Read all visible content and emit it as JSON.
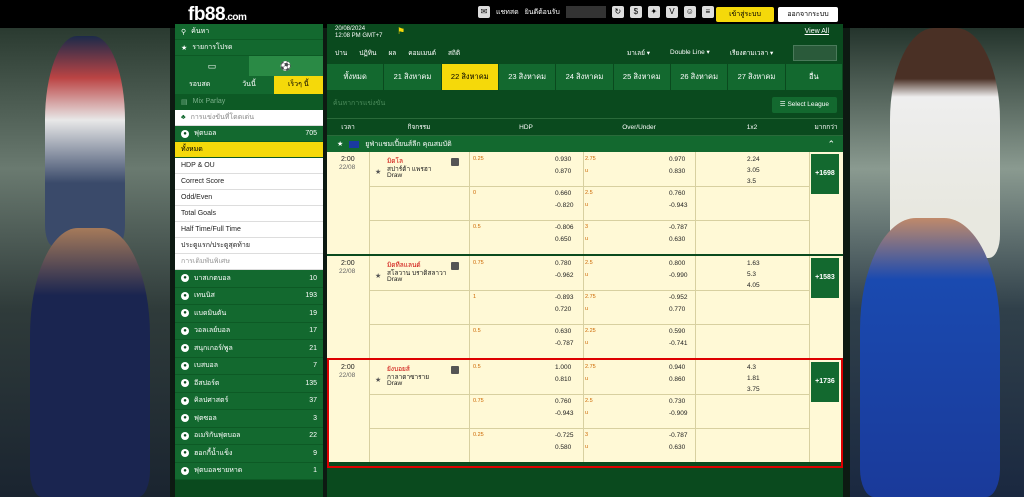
{
  "brand": {
    "logo": "fb88",
    "logo_suffix": ".com"
  },
  "topbar": {
    "items": [
      "แชทสด",
      "ยินดีต้อนรับ"
    ],
    "login": "เข้าสู่ระบบ",
    "signup": "ออกจากระบบ"
  },
  "sidebar": {
    "search": "ค้นหา",
    "favorites": "รายการโปรด",
    "tabs": [
      "รอบสด",
      "วันนี้",
      "เร็วๆ นี้"
    ],
    "mix_parlay": "Mix Parlay",
    "live_streaming": "การแข่งขันที่โดดเด่น",
    "football": "ฟุตบอล",
    "football_count": "705",
    "football_items": [
      "ทั้งหมด",
      "HDP & OU",
      "Correct Score",
      "Odd/Even",
      "Total Goals",
      "Half Time/Full Time",
      "ประตูแรก/ประตูสุดท้าย",
      "การเดิมพันพิเศษ"
    ],
    "sports": [
      {
        "name": "บาสเกตบอล",
        "count": "10"
      },
      {
        "name": "เทนนิส",
        "count": "193"
      },
      {
        "name": "แบดมินตัน",
        "count": "19"
      },
      {
        "name": "วอลเลย์บอล",
        "count": "17"
      },
      {
        "name": "สนุกเกอร์/พูล",
        "count": "21"
      },
      {
        "name": "เบสบอล",
        "count": "7"
      },
      {
        "name": "อีสปอร์ต",
        "count": "135"
      },
      {
        "name": "คิลปศาสตร์",
        "count": "37"
      },
      {
        "name": "ฟุตซอล",
        "count": "3"
      },
      {
        "name": "อเมริกันฟุตบอล",
        "count": "22"
      },
      {
        "name": "ฮอกกี้น้ำแข็ง",
        "count": "9"
      },
      {
        "name": "ฟุตบอลชายหาด",
        "count": "1"
      }
    ]
  },
  "main": {
    "date": "20/08/2024",
    "time": "12:08 PM GMT+7",
    "view_all": "View All",
    "filters": [
      "บ่าน",
      "ปฏิทิน",
      "ผล",
      "คอมเมนต์",
      "สถิติ"
    ],
    "filters_right": [
      "มาเลย์",
      "Double Line",
      "เรียงตามเวลา"
    ],
    "date_tabs": [
      "ทั้งหมด",
      "21 สิงหาคม",
      "22 สิงหาคม",
      "23 สิงหาคม",
      "24 สิงหาคม",
      "25 สิงหาคม",
      "26 สิงหาคม",
      "27 สิงหาคม",
      "อื่น"
    ],
    "select_placeholder": "ค้นหาการแข่งขัน",
    "select_league": "Select League",
    "columns": [
      "เวลา",
      "กิจกรรม",
      "HDP",
      "Over/Under",
      "1x2",
      "มากกว่า"
    ],
    "league": "ยูฟ่าแชมเปี้ยนส์ลีก คุณสมบัติ",
    "matches": [
      {
        "time": "2:00",
        "date": "22/08",
        "home": "มิดโล",
        "away": "สปาร์ต้า แพรฮา",
        "draw": "Draw",
        "more": "+1698",
        "rows": [
          {
            "hdp": "0.25",
            "h1": "0.930",
            "h2": "0.870",
            "ou": "2.75",
            "ou2": "u",
            "o1": "0.970",
            "o2": "0.830",
            "x1": "2.24",
            "x2": "3.05",
            "x3": "3.5"
          },
          {
            "hdp": "0",
            "h1": "0.660",
            "h2": "-0.820",
            "ou": "2.5",
            "ou2": "u",
            "o1": "0.760",
            "o2": "-0.943"
          },
          {
            "hdp": "0.5",
            "h1": "-0.806",
            "h2": "0.650",
            "ou": "3",
            "ou2": "u",
            "o1": "-0.787",
            "o2": "0.630"
          }
        ]
      },
      {
        "time": "2:00",
        "date": "22/08",
        "home": "มิดทีลแลนด์",
        "away": "สโลวาน บราติสลาวา",
        "draw": "Draw",
        "more": "+1583",
        "rows": [
          {
            "hdp": "0.75",
            "h1": "0.780",
            "h2": "-0.962",
            "ou": "2.5",
            "ou2": "u",
            "o1": "0.800",
            "o2": "-0.990",
            "x1": "1.63",
            "x2": "5.3",
            "x3": "4.05"
          },
          {
            "hdp": "1",
            "h1": "-0.893",
            "h2": "0.720",
            "ou": "2.75",
            "ou2": "u",
            "o1": "-0.952",
            "o2": "0.770"
          },
          {
            "hdp": "0.5",
            "h1": "0.630",
            "h2": "-0.787",
            "ou": "2.25",
            "ou2": "u",
            "o1": "0.590",
            "o2": "-0.741"
          }
        ]
      },
      {
        "time": "2:00",
        "date": "22/08",
        "home": "ยังบอยส์",
        "away": "กาลาตาซาราย",
        "draw": "Draw",
        "more": "+1736",
        "rows": [
          {
            "hdp": "0.5",
            "h1": "1.000",
            "h2": "0.810",
            "ou": "2.75",
            "ou2": "u",
            "o1": "0.940",
            "o2": "0.860",
            "x1": "4.3",
            "x2": "1.81",
            "x3": "3.75"
          },
          {
            "hdp": "0.75",
            "h1": "0.760",
            "h2": "-0.943",
            "ou": "2.5",
            "ou2": "u",
            "o1": "0.730",
            "o2": "-0.909"
          },
          {
            "hdp": "0.25",
            "h1": "-0.725",
            "h2": "0.580",
            "ou": "3",
            "ou2": "u",
            "o1": "-0.787",
            "o2": "0.630"
          }
        ]
      }
    ]
  },
  "colors": {
    "dark_green": "#0a4a1e",
    "green": "#13692f",
    "yellow": "#f5d90a",
    "cream": "#fff9d6",
    "red_highlight": "#d00000"
  }
}
